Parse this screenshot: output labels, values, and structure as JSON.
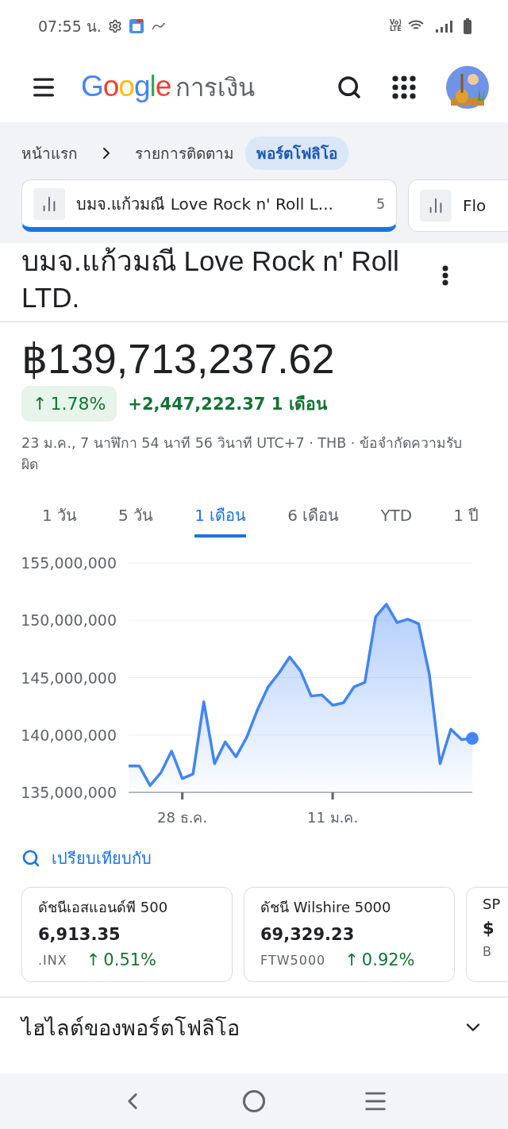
{
  "status_bar": {
    "time": "07:55 น.",
    "network": {
      "top": "Vo)",
      "bottom": "LTE"
    }
  },
  "header": {
    "logo": "Google",
    "product": "การเงิน"
  },
  "breadcrumb": {
    "items": [
      {
        "label": "หน้าแรก",
        "selected": false
      },
      {
        "label": "รายการติดตาม",
        "selected": false
      },
      {
        "label": "พอร์ตโฟลิโอ",
        "selected": true
      }
    ]
  },
  "portfolio_tabs": [
    {
      "label": "บมจ.แก้วมณี Love Rock n' Roll L...",
      "count": "5",
      "selected": true
    },
    {
      "label": "Flo",
      "selected": false
    }
  ],
  "title": "บมจ.แก้วมณี Love Rock n' Roll LTD.",
  "price": "฿139,713,237.62",
  "change": {
    "arrow": "↑",
    "percent": "1.78%",
    "amount": "+2,447,222.37",
    "period": "1 เดือน"
  },
  "timestamp": "23 ม.ค., 7 นาฬิกา 54 นาที 56 วินาที UTC+7 · THB · ข้อจำกัดความรับผิด",
  "ranges": [
    {
      "label": "1 วัน",
      "selected": false
    },
    {
      "label": "5 วัน",
      "selected": false
    },
    {
      "label": "1 เดือน",
      "selected": true
    },
    {
      "label": "6 เดือน",
      "selected": false
    },
    {
      "label": "YTD",
      "selected": false
    },
    {
      "label": "1 ปี",
      "selected": false
    }
  ],
  "chart_data": {
    "type": "area",
    "grid": true,
    "categories": [
      null,
      null,
      null,
      null,
      null,
      "28 ธ.ค.",
      null,
      null,
      null,
      null,
      null,
      null,
      null,
      null,
      null,
      null,
      null,
      null,
      null,
      "11 ม.ค.",
      null,
      null,
      null,
      null,
      null,
      null,
      null,
      null,
      null,
      null,
      null,
      null,
      null
    ],
    "series": [
      {
        "color": "#4285f4",
        "values": [
          137300000,
          137300000,
          135600000,
          136700000,
          138600000,
          136200000,
          136600000,
          142900000,
          137500000,
          139400000,
          138100000,
          139800000,
          142200000,
          144200000,
          145400000,
          146800000,
          145600000,
          143400000,
          143500000,
          142600000,
          142800000,
          144200000,
          144600000,
          150300000,
          151400000,
          149800000,
          150100000,
          149700000,
          145300000,
          137500000,
          140500000,
          139600000,
          139700000
        ]
      }
    ],
    "ylim": [
      135000000,
      155000000
    ],
    "yticks": [
      {
        "value": 135000000,
        "label": "135,000,000"
      },
      {
        "value": 140000000,
        "label": "140,000,000"
      },
      {
        "value": 145000000,
        "label": "145,000,000"
      },
      {
        "value": 150000000,
        "label": "150,000,000"
      },
      {
        "value": 155000000,
        "label": "155,000,000"
      }
    ]
  },
  "compare": {
    "label": "เปรียบเทียบกับ"
  },
  "cards": [
    {
      "name": "ดัชนีเอสแอนด์พี 500",
      "value": "6,913.35",
      "symbol": ".INX",
      "arrow": "↑",
      "change": "0.51%"
    },
    {
      "name": "ดัชนี Wilshire 5000",
      "value": "69,329.23",
      "symbol": "FTW5000",
      "arrow": "↑",
      "change": "0.92%"
    },
    {
      "name": "SP",
      "value": "$",
      "symbol": "B"
    }
  ],
  "highlights": {
    "label": "ไฮไลต์ของพอร์ตโฟลิโอ",
    "expanded": false
  }
}
